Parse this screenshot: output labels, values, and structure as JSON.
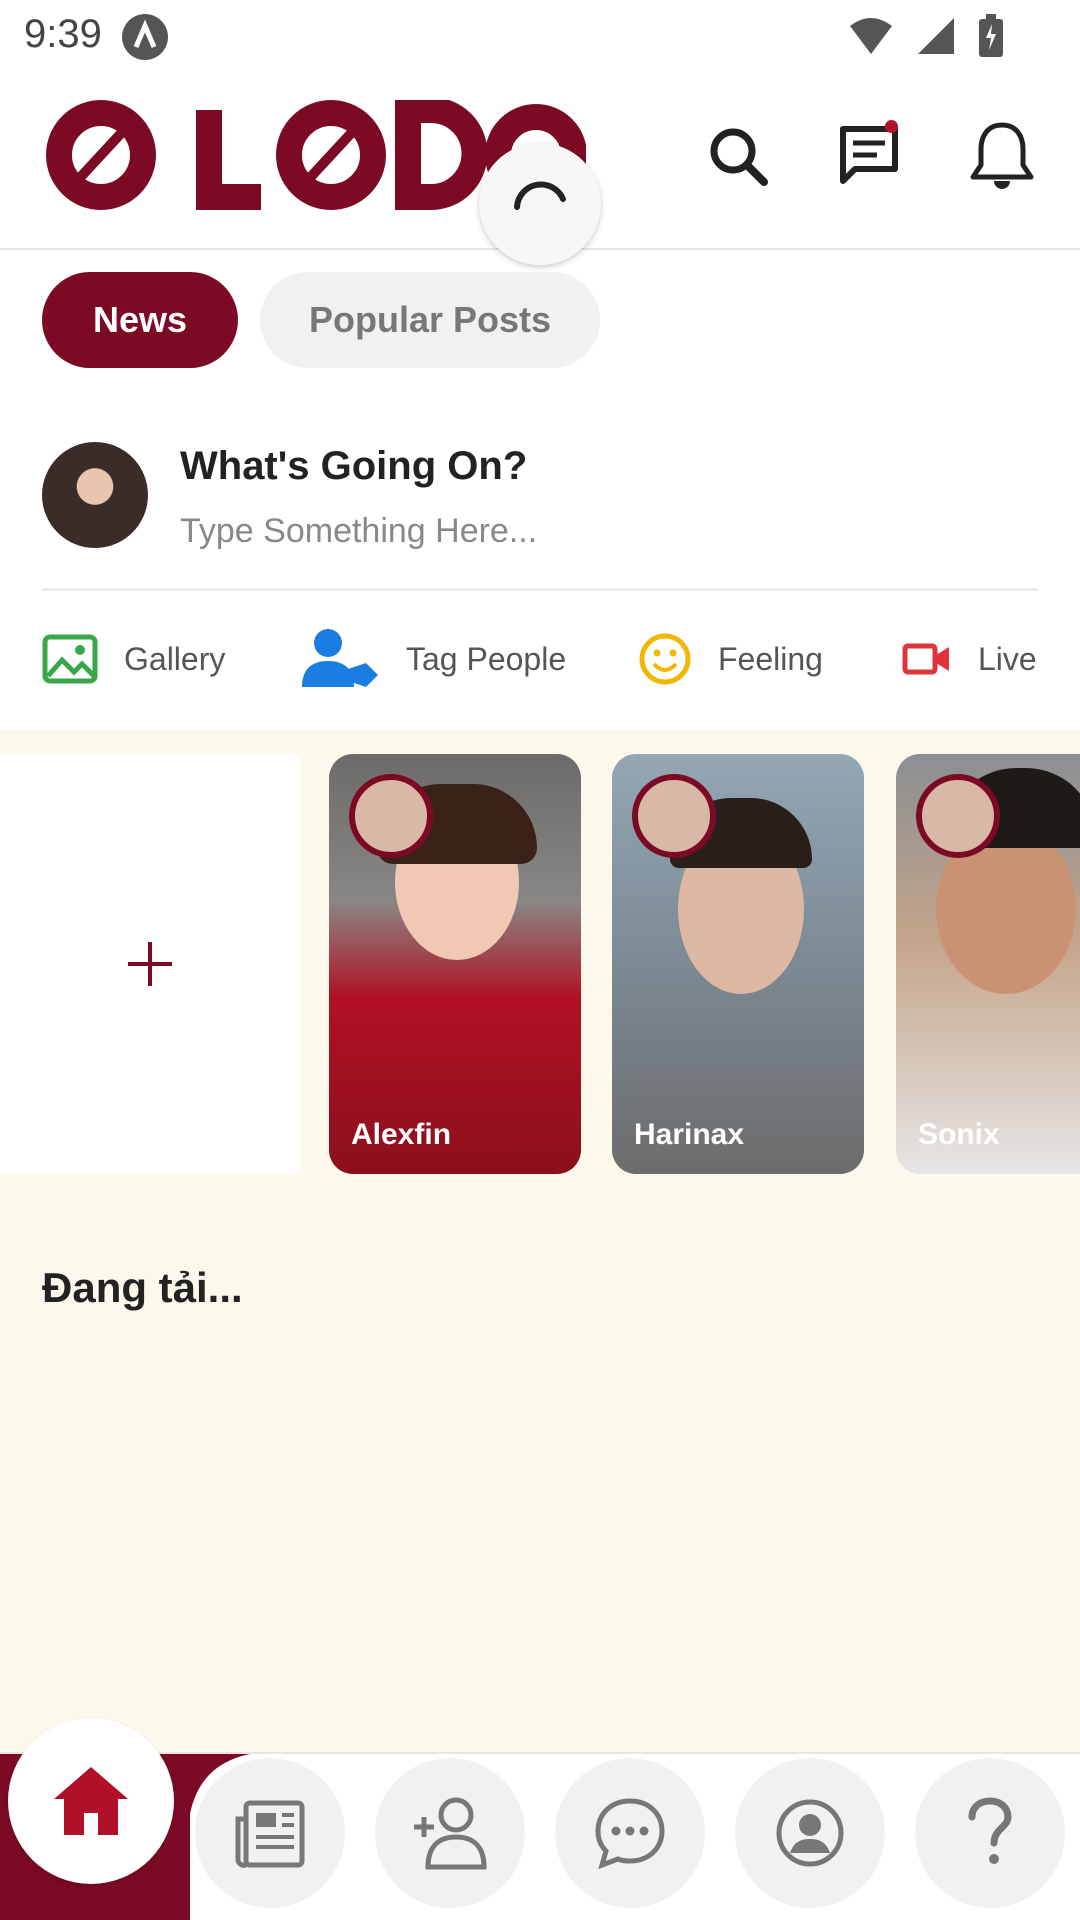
{
  "status_bar": {
    "time": "9:39"
  },
  "header": {
    "logo_text": "OLODO",
    "icons": [
      "search-icon",
      "message-icon",
      "bell-icon"
    ],
    "accent_color": "#7c0a25"
  },
  "tabs": [
    {
      "label": "News",
      "active": true
    },
    {
      "label": "Popular Posts",
      "active": false
    }
  ],
  "composer": {
    "title": "What's Going On?",
    "placeholder": "Type Something Here..."
  },
  "actions": [
    {
      "label": "Gallery",
      "icon": "gallery-icon"
    },
    {
      "label": "Tag People",
      "icon": "tag-people-icon"
    },
    {
      "label": "Feeling",
      "icon": "feeling-icon"
    },
    {
      "label": "Live",
      "icon": "live-icon"
    }
  ],
  "stories": [
    {
      "name": "Alexfin"
    },
    {
      "name": "Harinax"
    },
    {
      "name": "Sonix"
    }
  ],
  "feed": {
    "loading_text": "Đang tải..."
  },
  "bottom_nav": [
    "home-icon",
    "news-icon",
    "add-friend-icon",
    "chat-icon",
    "profile-icon",
    "help-icon"
  ]
}
